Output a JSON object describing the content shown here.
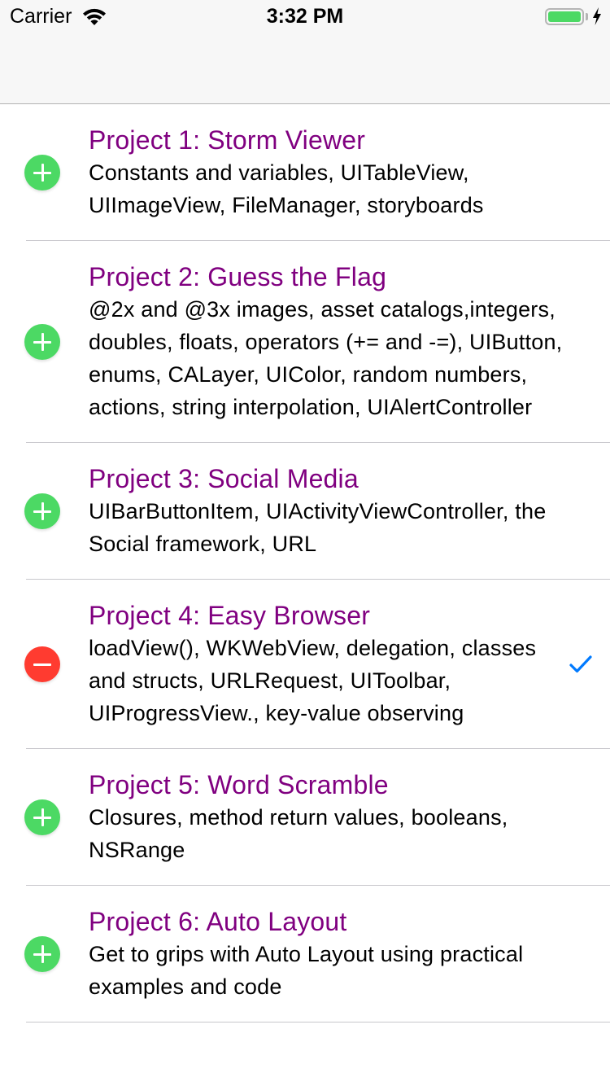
{
  "status_bar": {
    "carrier": "Carrier",
    "time": "3:32 PM",
    "battery_level": 1.0,
    "battery_color": "#4cd964"
  },
  "nav_bar": {
    "title": ""
  },
  "colors": {
    "title": "#800080",
    "insert_control": "#4cd964",
    "delete_control": "#ff3b30",
    "checkmark": "#007aff"
  },
  "projects": [
    {
      "title": "Project 1: Storm Viewer",
      "subtitle": "Constants and variables, UITableView, UIImageView, FileManager, storyboards",
      "edit_control": "insert",
      "checked": false
    },
    {
      "title": "Project 2: Guess the Flag",
      "subtitle": "@2x and @3x images, asset catalogs,integers, doubles, floats, operators (+= and -=), UIButton, enums, CALayer, UIColor, random numbers, actions, string interpolation, UIAlertController",
      "edit_control": "insert",
      "checked": false
    },
    {
      "title": "Project 3: Social Media",
      "subtitle": "UIBarButtonItem, UIActivityViewController, the Social framework, URL",
      "edit_control": "insert",
      "checked": false
    },
    {
      "title": "Project 4: Easy Browser",
      "subtitle": "loadView(), WKWebView, delegation, classes and structs, URLRequest, UIToolbar, UIProgressView., key-value observing",
      "edit_control": "delete",
      "checked": true
    },
    {
      "title": "Project 5: Word Scramble",
      "subtitle": "Closures, method return values, booleans, NSRange",
      "edit_control": "insert",
      "checked": false
    },
    {
      "title": "Project 6: Auto Layout",
      "subtitle": "Get to grips with Auto Layout using practical examples and code",
      "edit_control": "insert",
      "checked": false
    }
  ]
}
